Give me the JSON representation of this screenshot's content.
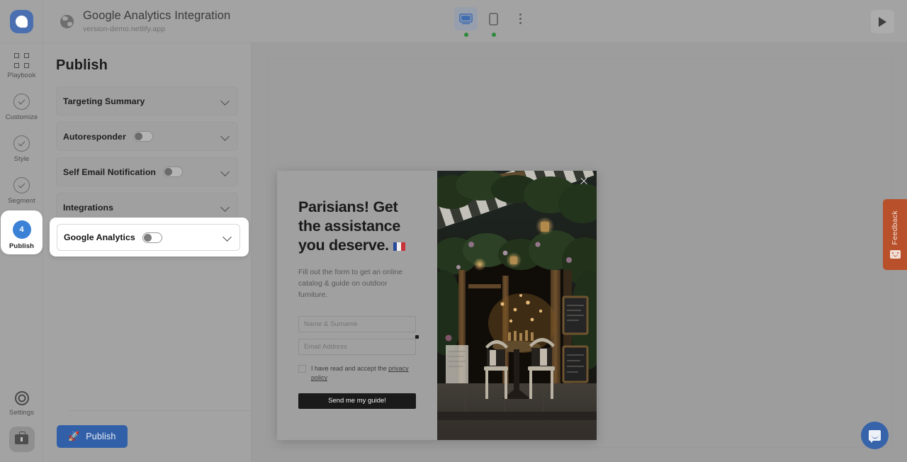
{
  "header": {
    "logo_icon": "chat-bubble-logo",
    "site_icon": "globe-icon",
    "site_title": "Google Analytics Integration",
    "site_url": "version-demo.netlify.app",
    "desktop_icon": "desktop-monitor-icon",
    "mobile_icon": "mobile-phone-icon",
    "kebab_icon": "more-options-icon",
    "play_icon": "play-icon"
  },
  "rail": {
    "items": [
      {
        "label": "Playbook",
        "icon": "grid-icon"
      },
      {
        "label": "Customize",
        "icon": "check-circle-icon"
      },
      {
        "label": "Style",
        "icon": "check-circle-icon"
      },
      {
        "label": "Segment",
        "icon": "check-circle-icon"
      },
      {
        "label": "Publish",
        "icon": "step-badge",
        "badge": "4"
      }
    ],
    "settings_label": "Settings",
    "settings_icon": "gear-icon",
    "toolbox_icon": "toolbox-icon"
  },
  "panel": {
    "title": "Publish",
    "accordions": [
      {
        "label": "Targeting Summary",
        "has_toggle": false,
        "chevron": "chevron-down-icon"
      },
      {
        "label": "Autoresponder",
        "has_toggle": true,
        "toggle_state": "off",
        "chevron": "chevron-down-icon"
      },
      {
        "label": "Self Email Notification",
        "has_toggle": true,
        "toggle_state": "off",
        "chevron": "chevron-down-icon"
      },
      {
        "label": "Integrations",
        "has_toggle": false,
        "chevron": "chevron-down-icon"
      }
    ],
    "highlighted": {
      "label": "Google Analytics",
      "toggle_state": "off",
      "chevron": "chevron-down-icon"
    },
    "publish_button": {
      "label": "Publish",
      "icon": "rocket-icon",
      "color": "#3260a8"
    }
  },
  "modal": {
    "close_icon": "close-icon",
    "headline": "Parisians! Get the assistance you deserve.",
    "headline_flag": "france-flag-icon",
    "subtext": "Fill out the form to get an online catalog & guide on outdoor furniture.",
    "fields": [
      {
        "name": "name-field",
        "placeholder": "Name & Surname",
        "value": "",
        "required": false
      },
      {
        "name": "email-field",
        "placeholder": "Email Address",
        "value": "",
        "required": true
      }
    ],
    "consent_text": "I have read and accept the ",
    "consent_link": "privacy policy",
    "checkbox_state": "unchecked",
    "submit_label": "Send me my guide!",
    "image_alt": "parisian-cafe-storefront-photo"
  },
  "feedback_tab": {
    "label": "Feedback",
    "icon": "smiley-face-icon",
    "color": "#b8512b"
  },
  "chat_widget": {
    "icon": "chat-bubble-icon",
    "color": "#3763ab"
  }
}
